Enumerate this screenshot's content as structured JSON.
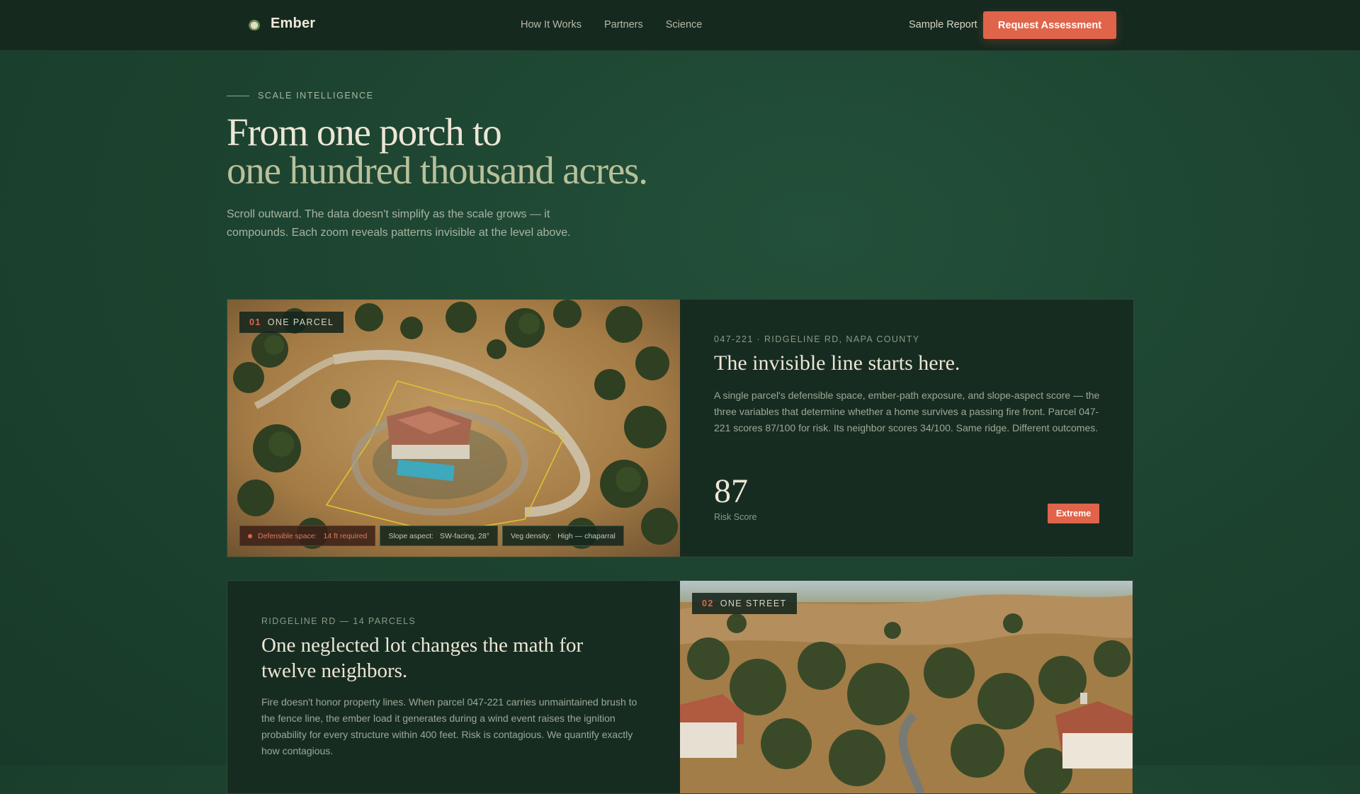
{
  "nav": {
    "brand": "Ember",
    "links": [
      "How It Works",
      "Partners",
      "Science"
    ],
    "sample_report": "Sample Report",
    "cta": "Request Assessment"
  },
  "hero": {
    "eyebrow": "SCALE INTELLIGENCE",
    "title_line1": "From one porch to",
    "title_line2": "one hundred thousand acres.",
    "lede": "Scroll outward. The data doesn't simplify as the scale grows — it compounds. Each zoom reveals patterns invisible at the level above."
  },
  "card1": {
    "tag_num": "01",
    "tag_label": "ONE PARCEL",
    "chips": [
      {
        "key": "Defensible space:",
        "value": "14 ft required"
      },
      {
        "key": "Slope aspect:",
        "value": "SW-facing, 28°"
      },
      {
        "key": "Veg density:",
        "value": "High — chaparral"
      }
    ],
    "meta": "047-221 · RIDGELINE RD, NAPA COUNTY",
    "title": "The invisible line starts here.",
    "body": "A single parcel's defensible space, ember-path exposure, and slope-aspect score — the three variables that determine whether a home survives a passing fire front. Parcel 047-221 scores 87/100 for risk. Its neighbor scores 34/100. Same ridge. Different outcomes.",
    "score": "87",
    "score_label": "Risk Score",
    "badge": "Extreme"
  },
  "card2": {
    "tag_num": "02",
    "tag_label": "ONE STREET",
    "meta": "RIDGELINE RD — 14 PARCELS",
    "title_line1": "One neglected lot changes the math for",
    "title_line2": "twelve neighbors.",
    "body": "Fire doesn't honor property lines. When parcel 047-221 carries unmaintained brush to the fence line, the ember load it generates during a wind event raises the ignition probability for every structure within 400 feet. Risk is contagious. We quantify exactly how contagious."
  },
  "colors": {
    "accent": "#e0644a",
    "nav_bg": "#15291f",
    "card_bg": "#172c21",
    "page_bg": "#1d4430"
  }
}
